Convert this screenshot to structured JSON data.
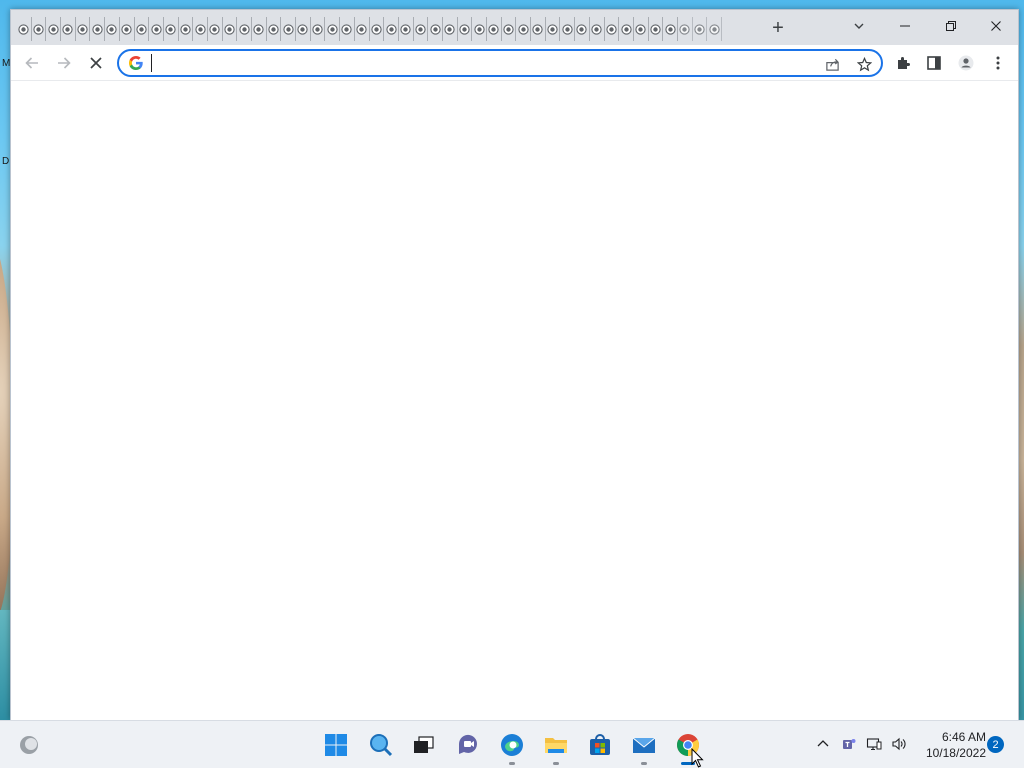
{
  "desktop": {
    "icon_labels": [
      "M",
      "D"
    ]
  },
  "browser": {
    "tab_count_visible": 48,
    "new_tab_label": "+",
    "omnibox": {
      "value": "",
      "placeholder": ""
    },
    "accent_color": "#1a73e8",
    "icons": {
      "back": "arrow-left-icon",
      "forward": "arrow-right-icon",
      "stop": "close-icon",
      "share": "share-icon",
      "bookmark": "star-icon",
      "extensions": "puzzle-icon",
      "side_panel": "side-panel-icon",
      "profile": "profile-icon",
      "menu": "kebab-menu-icon",
      "tab_search": "chevron-down-icon",
      "minimize": "minimize-icon",
      "restore": "restore-icon",
      "close": "close-icon"
    }
  },
  "taskbar": {
    "apps": [
      "widgets",
      "start",
      "search",
      "task-view",
      "teams-chat",
      "edge",
      "file-explorer",
      "store",
      "mail",
      "chrome"
    ],
    "clock": {
      "time": "6:46 AM",
      "date": "10/18/2022"
    },
    "notification_count": "2"
  }
}
